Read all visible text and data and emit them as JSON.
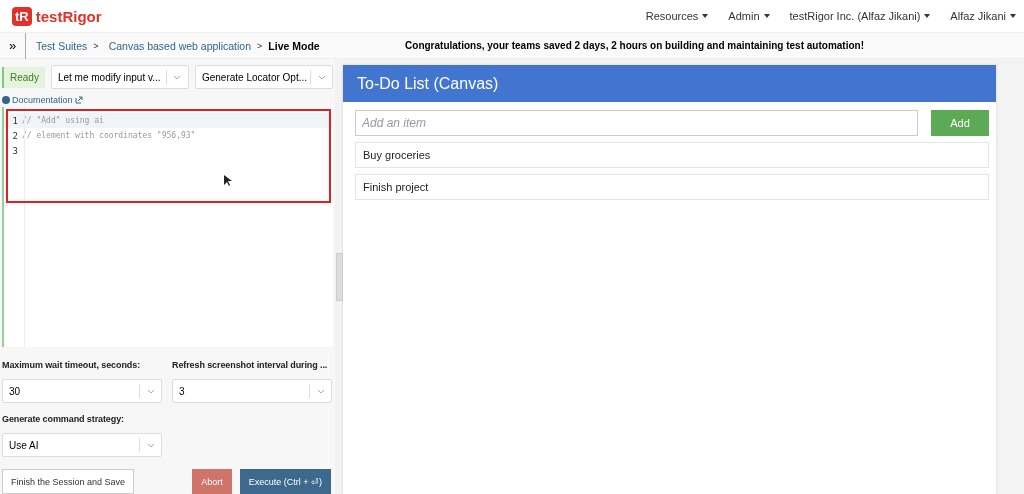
{
  "logo": {
    "mark": "tR",
    "name": "testRigor"
  },
  "nav": [
    {
      "label": "Resources"
    },
    {
      "label": "Admin"
    },
    {
      "label": "testRigor Inc. (Alfaz Jikani)"
    },
    {
      "label": "Alfaz Jikani"
    }
  ],
  "breadcrumb": {
    "toggle": "»",
    "items": [
      "Test Suites",
      "Canvas based web application"
    ],
    "separator": ">",
    "current": "Live Mode"
  },
  "banner": "Congratulations, your teams saved 2 days, 2 hours on building and maintaining test automation!",
  "status": "Ready",
  "mode_select": {
    "value": "Let me modify input v..."
  },
  "locator_select": {
    "value": "Generate Locator Opt..."
  },
  "documentation_link": "Documentation",
  "editor": {
    "highlighted": true,
    "lines": [
      {
        "number": "1",
        "code": "// \"Add\" using ai",
        "active": true
      },
      {
        "number": "2",
        "code": "// element with coordinates \"956,93\"",
        "active": false
      },
      {
        "number": "3",
        "active": false
      }
    ]
  },
  "settings": [
    {
      "label": "Maximum wait timeout, seconds:",
      "value": "30"
    },
    {
      "label": "Refresh screenshot interval during ...",
      "value": "3"
    },
    {
      "label": "Generate command strategy:",
      "value": "Use AI"
    }
  ],
  "buttons": {
    "finish": "Finish the Session and Save",
    "abort": "Abort",
    "execute": "Execute (Ctrl + ⏎)"
  },
  "app": {
    "title": "To-Do List (Canvas)",
    "input_placeholder": "Add an item",
    "add_button": "Add",
    "items": [
      "Buy groceries",
      "Finish project"
    ]
  }
}
